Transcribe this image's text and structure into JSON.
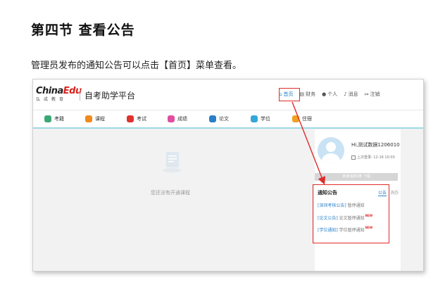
{
  "doc": {
    "title": "第四节  查看公告",
    "paragraph": "管理员发布的通知公告可以点击【首页】菜单查看。"
  },
  "app": {
    "logo_main_a": "China",
    "logo_main_b": "Edu",
    "logo_sub": "弘成教育",
    "title": "自考助学平台"
  },
  "topnav": [
    {
      "label": "首页",
      "icon": "home-icon",
      "glyph": "⌂"
    },
    {
      "label": "财务",
      "icon": "finance-icon",
      "glyph": "▤"
    },
    {
      "label": "个人",
      "icon": "user-icon",
      "glyph": "●"
    },
    {
      "label": "消息",
      "icon": "bell-icon",
      "glyph": "♪"
    },
    {
      "label": "注销",
      "icon": "logout-icon",
      "glyph": "↦"
    }
  ],
  "menu": [
    {
      "label": "考籍",
      "icon": "register-icon",
      "color": "#3aa876"
    },
    {
      "label": "课程",
      "icon": "course-icon",
      "color": "#f08a1c"
    },
    {
      "label": "考试",
      "icon": "exam-icon",
      "color": "#e0322f"
    },
    {
      "label": "成绩",
      "icon": "score-icon",
      "color": "#e04ea0"
    },
    {
      "label": "论文",
      "icon": "paper-icon",
      "color": "#2a80c8"
    },
    {
      "label": "学位",
      "icon": "degree-icon",
      "color": "#35a7d8"
    },
    {
      "label": "住宿",
      "icon": "lodging-icon",
      "color": "#f0a020"
    }
  ],
  "main": {
    "empty_text": "您还没有开通课程"
  },
  "profile": {
    "name": "Hi,测试数据1206010",
    "last_login": "上次登录: 12-16 10:03",
    "unread": "未读消息0条 下载"
  },
  "notice": {
    "title": "通知公告",
    "tab_active": "公告",
    "tab_other": "消办",
    "rows": [
      {
        "tag": "[深圳考核公告]",
        "text": "暂停通知",
        "is_new": false
      },
      {
        "tag": "[论文公告]",
        "text": "论文暂停通知",
        "is_new": true
      },
      {
        "tag": "[学位通知]",
        "text": "学位暂停通知",
        "is_new": true
      }
    ],
    "new_badge": "NEW"
  },
  "colors": {
    "highlight": "#e02b2b",
    "accent": "#2a80c8",
    "menu_underline": "#9ed9e3"
  }
}
